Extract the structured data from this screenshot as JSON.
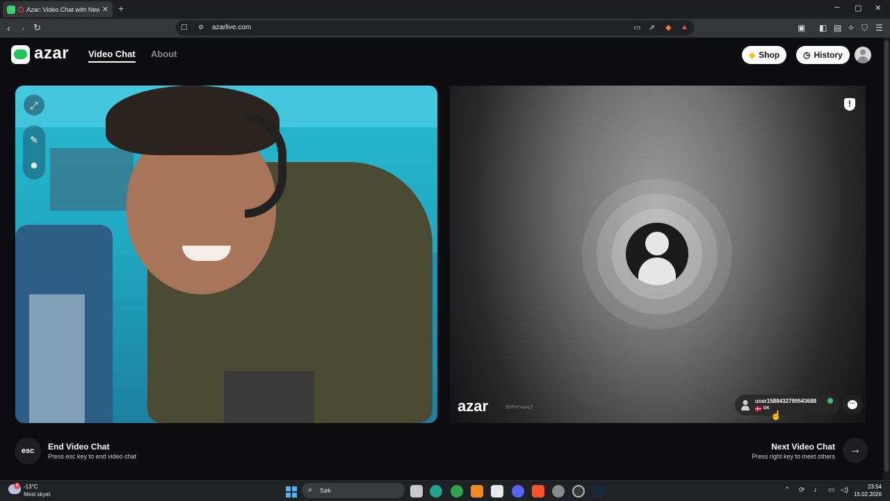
{
  "browser": {
    "tab_title": "Azar: Video Chat with New Pe",
    "new_tab": "+",
    "url": "azarlive.com",
    "window_controls": {
      "minimize": "─",
      "maximize": "▢",
      "close": "✕"
    }
  },
  "header": {
    "logo_text": "azar",
    "nav": {
      "video_chat": "Video Chat",
      "about": "About"
    },
    "shop_label": "Shop",
    "history_label": "History"
  },
  "remote": {
    "logo_text": "azar",
    "code": "5DFPIYawqT",
    "user_name": "user1588432799543688",
    "country": "DK"
  },
  "controls": {
    "esc_label": "esc",
    "end_title": "End Video Chat",
    "end_sub": "Press esc key to end video chat",
    "next_title": "Next Video Chat",
    "next_sub": "Press right key to meet others",
    "next_arrow": "→"
  },
  "taskbar": {
    "weather_badge": "2",
    "weather_temp": "-13°C",
    "weather_desc": "Mest skyet",
    "search_placeholder": "Søk",
    "time": "23:54",
    "date": "15.02.2026"
  },
  "colors": {
    "accent_green": "#23c45a",
    "camera_cyan": "#27b9d1",
    "page_bg": "#0d0d0f"
  }
}
